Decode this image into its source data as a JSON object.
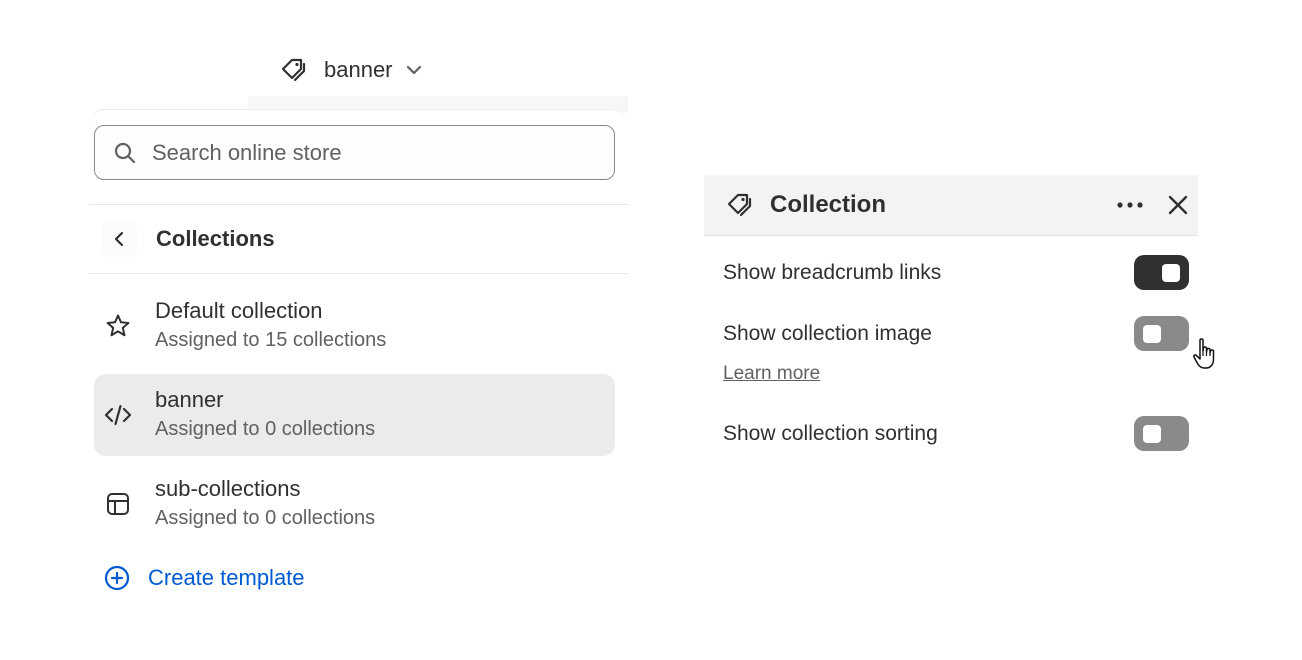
{
  "template_selector": {
    "label": "banner",
    "icon": "tag-icon"
  },
  "search": {
    "placeholder": "Search online store",
    "value": ""
  },
  "collections": {
    "title": "Collections",
    "items": [
      {
        "name": "Default collection",
        "subtitle": "Assigned to 15 collections",
        "icon": "star-icon",
        "selected": false
      },
      {
        "name": "banner",
        "subtitle": "Assigned to 0 collections",
        "icon": "code-icon",
        "selected": true
      },
      {
        "name": "sub-collections",
        "subtitle": "Assigned to 0 collections",
        "icon": "layout-icon",
        "selected": false
      }
    ],
    "create_label": "Create template"
  },
  "settings_panel": {
    "title": "Collection",
    "settings": [
      {
        "label": "Show breadcrumb links",
        "enabled": true
      },
      {
        "label": "Show collection image",
        "enabled": false
      },
      {
        "label": "Show collection sorting",
        "enabled": false
      }
    ],
    "learn_more": "Learn more"
  },
  "colors": {
    "accent": "#005bd3",
    "toggle_on": "#303030",
    "toggle_off": "#8a8a8a",
    "selected_bg": "#ebebeb"
  }
}
